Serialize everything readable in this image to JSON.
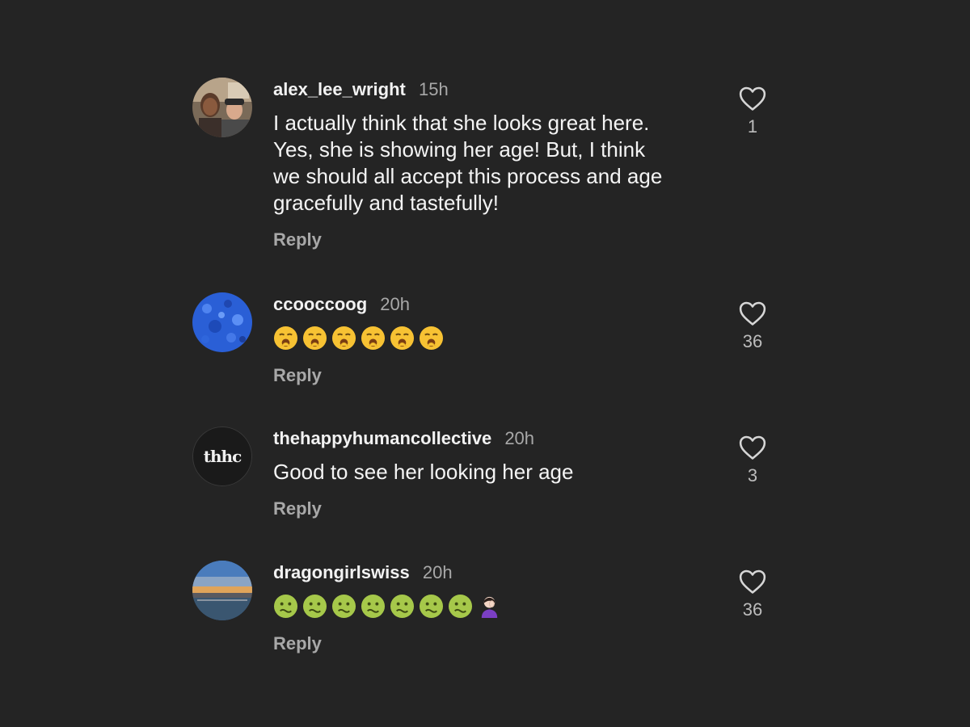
{
  "comments": [
    {
      "username": "alex_lee_wright",
      "time": "15h",
      "text_lines": [
        "I actually think that she looks great here.",
        "Yes, she is showing her age! But, I think",
        "we should all accept this process and age",
        "gracefully and tastefully!"
      ],
      "reply_label": "Reply",
      "likes": "1",
      "avatar_icon": "couple-photo-avatar"
    },
    {
      "username": "ccooccoog",
      "time": "20h",
      "emojis": [
        "yawning-face-icon",
        "yawning-face-icon",
        "yawning-face-icon",
        "yawning-face-icon",
        "yawning-face-icon",
        "yawning-face-icon"
      ],
      "reply_label": "Reply",
      "likes": "36",
      "avatar_icon": "blue-texture-avatar"
    },
    {
      "username": "thehappyhumancollective",
      "time": "20h",
      "text_lines": [
        "Good to see her looking her age"
      ],
      "reply_label": "Reply",
      "likes": "3",
      "avatar_logo_text": "thhc"
    },
    {
      "username": "dragongirlswiss",
      "time": "20h",
      "emojis": [
        "nauseated-face-icon",
        "nauseated-face-icon",
        "nauseated-face-icon",
        "nauseated-face-icon",
        "nauseated-face-icon",
        "nauseated-face-icon",
        "nauseated-face-icon",
        "person-facepalming-icon"
      ],
      "reply_label": "Reply",
      "likes": "36",
      "avatar_icon": "sunset-lake-avatar"
    }
  ],
  "colors": {
    "background": "#242424",
    "username": "#f2f2f2",
    "secondary_text": "#a8a8a8"
  }
}
